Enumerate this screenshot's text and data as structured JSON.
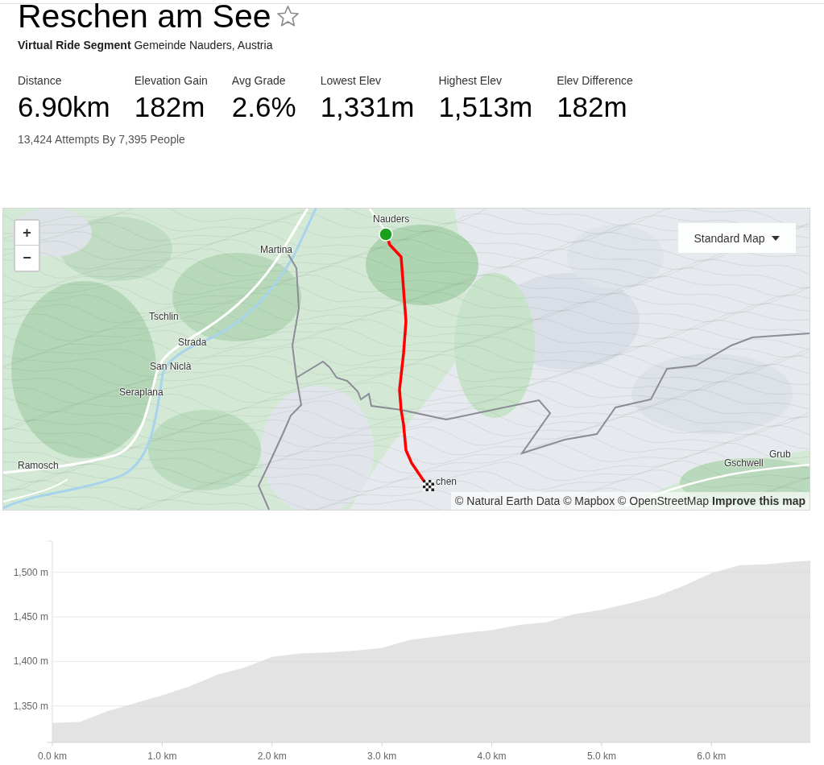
{
  "segment": {
    "title": "Reschen am See",
    "starred": false,
    "subtitle": "**Virtual Ride Segment** Gemeinde Nauders, Austria"
  },
  "stats": [
    {
      "label": "Distance",
      "value": "6.90km"
    },
    {
      "label": "Elevation Gain",
      "value": "182m"
    },
    {
      "label": "Avg Grade",
      "value": "2.6%"
    },
    {
      "label": "Lowest Elev",
      "value": "1,331m"
    },
    {
      "label": "Highest Elev",
      "value": "1,513m"
    },
    {
      "label": "Elev Difference",
      "value": "182m"
    }
  ],
  "attempts": "13,424 Attempts By 7,395 People",
  "map": {
    "zoom_in": "+",
    "zoom_out": "−",
    "style_dropdown": "Standard Map",
    "places": [
      {
        "name": "Nauders"
      },
      {
        "name": "Martina"
      },
      {
        "name": "Tschlin"
      },
      {
        "name": "Strada"
      },
      {
        "name": "San Niclà"
      },
      {
        "name": "Seraplana"
      },
      {
        "name": "Ramosch"
      },
      {
        "name": "Gschwell"
      },
      {
        "name": "Grub"
      },
      {
        "name": "chen"
      }
    ],
    "attribution": "© Natural Earth Data © Mapbox © OpenStreetMap",
    "improve_link": "Improve this map"
  },
  "elevation_profile": {
    "chart_data": {
      "type": "area",
      "x": [
        0,
        0.25,
        0.5,
        0.75,
        1,
        1.25,
        1.5,
        1.75,
        2,
        2.25,
        2.5,
        2.75,
        3,
        3.25,
        3.5,
        3.75,
        4,
        4.25,
        4.5,
        4.75,
        5,
        5.25,
        5.5,
        5.75,
        6,
        6.25,
        6.5,
        6.75,
        6.9
      ],
      "values": [
        1331,
        1332,
        1344,
        1353,
        1362,
        1372,
        1385,
        1393,
        1405,
        1409,
        1410,
        1412,
        1415,
        1424,
        1428,
        1432,
        1435,
        1441,
        1444,
        1453,
        1458,
        1465,
        1473,
        1485,
        1499,
        1508,
        1509,
        1512,
        1513
      ],
      "xlim": [
        0,
        6.9
      ],
      "ylim": [
        1309,
        1535
      ],
      "grid": true,
      "xticks": [
        {
          "value": 0,
          "label": "0.0 km"
        },
        {
          "value": 1,
          "label": "1.0 km"
        },
        {
          "value": 2,
          "label": "2.0 km"
        },
        {
          "value": 3,
          "label": "3.0 km"
        },
        {
          "value": 4,
          "label": "4.0 km"
        },
        {
          "value": 5,
          "label": "5.0 km"
        },
        {
          "value": 6,
          "label": "6.0 km"
        }
      ],
      "yticks": [
        {
          "value": 1350,
          "label": "1,350 m"
        },
        {
          "value": 1400,
          "label": "1,400 m"
        },
        {
          "value": 1450,
          "label": "1,450 m"
        },
        {
          "value": 1500,
          "label": "1,500 m"
        }
      ]
    }
  }
}
